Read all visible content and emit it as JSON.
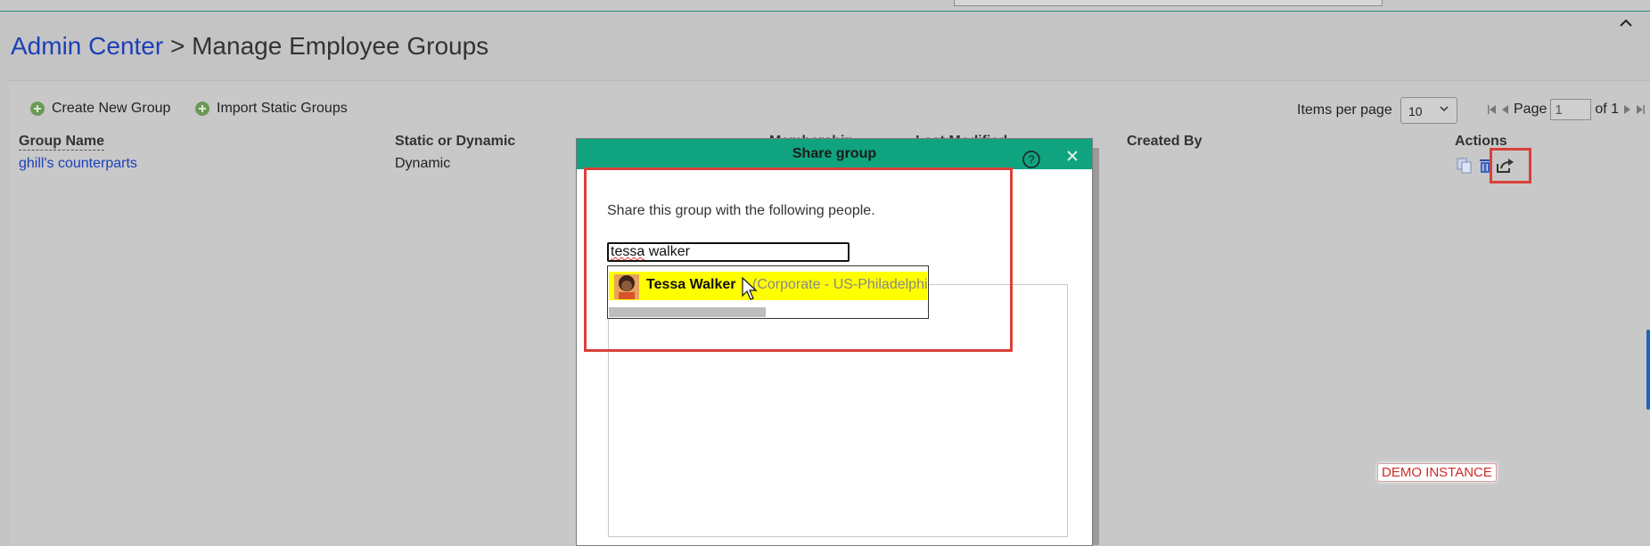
{
  "header": {
    "breadcrumb_root": "Admin Center",
    "separator": " > ",
    "page_title": "Manage Employee Groups"
  },
  "toolbar": {
    "create_label": "Create New Group",
    "import_label": "Import Static Groups",
    "items_per_page_label": "Items per page",
    "items_per_page_value": "10",
    "page_label": "Page",
    "page_value": "1",
    "page_total": "of 1"
  },
  "table": {
    "columns": [
      "Group Name",
      "Static or Dynamic",
      "Membership",
      "Last Modified",
      "Created By",
      "Actions"
    ],
    "rows": [
      {
        "group_name": "ghill's counterparts",
        "type": "Dynamic"
      }
    ]
  },
  "dialog": {
    "title": "Share group",
    "description": "Share this group with the following people.",
    "search_value": "tessa walker",
    "search_value_misspelled": "tessa",
    "search_value_rest": " walker",
    "suggestion": {
      "name": "Tessa Walker",
      "department": "(Corporate - US-Philadelphia)"
    }
  },
  "badges": {
    "demo": "DEMO INSTANCE"
  },
  "colors": {
    "accent_header": "#0fa37f",
    "link": "#1b3fb8",
    "highlight": "#ffff00",
    "annotation": "#d9403a"
  }
}
